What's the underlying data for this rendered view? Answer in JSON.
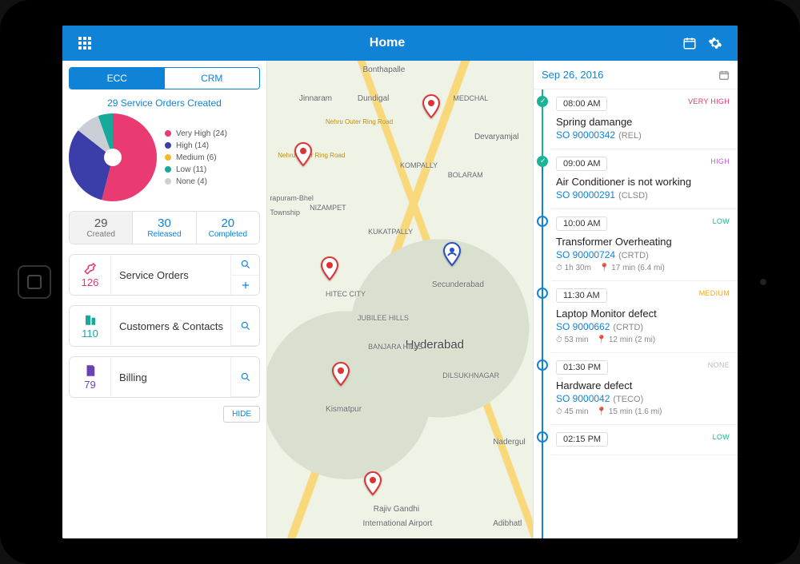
{
  "header": {
    "title": "Home"
  },
  "tabs": {
    "ecc": "ECC",
    "crm": "CRM"
  },
  "overview_title": "29 Service Orders Created",
  "chart_data": {
    "type": "pie",
    "title": "29 Service Orders Created",
    "categories": [
      "Very High",
      "High",
      "Medium",
      "Low",
      "None"
    ],
    "values": [
      24,
      14,
      6,
      11,
      4
    ],
    "series": [
      {
        "name": "Very High",
        "value": 24,
        "color": "#ea3a72"
      },
      {
        "name": "High",
        "value": 14,
        "color": "#3b3ea8"
      },
      {
        "name": "Medium",
        "value": 6,
        "color": "#f7b92b"
      },
      {
        "name": "Low",
        "value": 11,
        "color": "#17a99a"
      },
      {
        "name": "None",
        "value": 4,
        "color": "#c9cfd4"
      }
    ]
  },
  "legend": {
    "very_high": "Very High (24)",
    "high": "High (14)",
    "medium": "Medium (6)",
    "low": "Low (11)",
    "none": "None (4)"
  },
  "colors": {
    "very_high": "#ea3a72",
    "high": "#3b3ea8",
    "medium": "#f7b92b",
    "low": "#17a99a",
    "none": "#c9cfd4",
    "accent": "#1183d6"
  },
  "counters": {
    "created": {
      "num": "29",
      "label": "Created"
    },
    "released": {
      "num": "30",
      "label": "Released"
    },
    "completed": {
      "num": "20",
      "label": "Completed"
    }
  },
  "nav": {
    "service_orders": {
      "label": "Service Orders",
      "count": "126",
      "count_color": "#e8336f"
    },
    "customers": {
      "label": "Customers & Contacts",
      "count": "110",
      "count_color": "#17a99a"
    },
    "billing": {
      "label": "Billing",
      "count": "79",
      "count_color": "#6b3fb5"
    }
  },
  "hide_label": "HIDE",
  "map_labels": {
    "hyderabad": "Hyderabad",
    "secunderabad": "Secunderabad",
    "hitec": "HITEC CITY",
    "kismatpur": "Kismatpur",
    "jubilee": "JUBILEE HILLS",
    "banjara": "BANJARA HILLS",
    "kukatpally": "KUKATPALLY",
    "kompally": "KOMPALLY",
    "bolaram": "BOLARAM",
    "medchal": "MEDCHAL",
    "dundigal": "Dundigal",
    "bonthapalle": "Bonthapalle",
    "jinnaram": "Jinnaram",
    "devaryamjal": "Devaryamjal",
    "nizampet": "NIZAMPET",
    "dilsukh": "DILSUKHNAGAR",
    "nadergul": "Nadergul",
    "adibhatla": "Adibhatl",
    "rgia1": "Rajiv Gandhi",
    "rgia2": "International Airport",
    "ring1": "Nehru Outer Ring Road",
    "ring2": "Nehru Outer Ring Road",
    "bhel1": "rapuram-Bhel",
    "bhel2": "Township"
  },
  "date_selected": "Sep 26, 2016",
  "appointments": [
    {
      "time": "08:00 AM",
      "priority": "VERY HIGH",
      "prio_class": "vhigh",
      "title": "Spring damange",
      "so": "SO 90000342",
      "status": "(REL)",
      "done": true,
      "dur": "",
      "eta": ""
    },
    {
      "time": "09:00 AM",
      "priority": "HIGH",
      "prio_class": "high",
      "title": "Air Conditioner is not working",
      "so": "SO 90000291",
      "status": "(CLSD)",
      "done": true,
      "dur": "",
      "eta": ""
    },
    {
      "time": "10:00 AM",
      "priority": "LOW",
      "prio_class": "low",
      "title": "Transformer Overheating",
      "so": "SO 90000724",
      "status": "(CRTD)",
      "done": false,
      "dur": "1h 30m",
      "eta": "17 min (6.4 mi)"
    },
    {
      "time": "11:30 AM",
      "priority": "MEDIUM",
      "prio_class": "med",
      "title": "Laptop Monitor defect",
      "so": "SO 9000662",
      "status": "(CRTD)",
      "done": false,
      "dur": "53 min",
      "eta": "12 min (2 mi)"
    },
    {
      "time": "01:30 PM",
      "priority": "NONE",
      "prio_class": "none",
      "title": "Hardware defect",
      "so": "SO 9000042",
      "status": "(TECO)",
      "done": false,
      "dur": "45 min",
      "eta": "15 min (1.6 mi)"
    },
    {
      "time": "02:15 PM",
      "priority": "LOW",
      "prio_class": "low",
      "title": "",
      "so": "",
      "status": "",
      "done": false,
      "dur": "",
      "eta": ""
    }
  ]
}
